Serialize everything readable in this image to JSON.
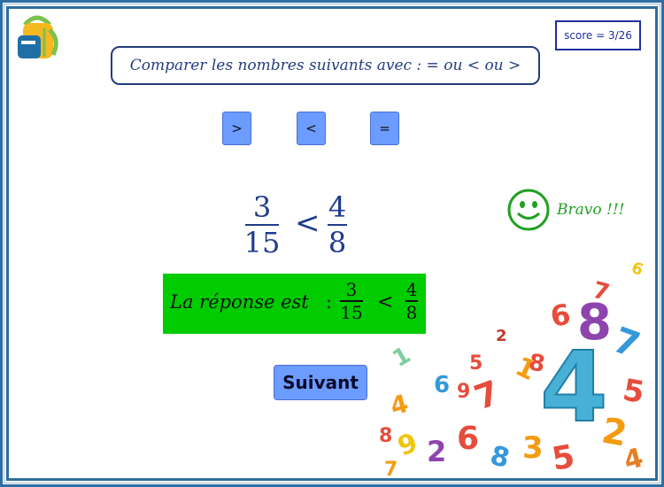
{
  "score": {
    "text": "score = 3/26"
  },
  "instruction": {
    "text": "Comparer les nombres suivants avec  :   = ou < ou >"
  },
  "operators": [
    {
      "label": ">"
    },
    {
      "label": "<"
    },
    {
      "label": "="
    }
  ],
  "comparison": {
    "left": {
      "numerator": "3",
      "denominator": "15"
    },
    "relation": "<",
    "right": {
      "numerator": "4",
      "denominator": "8"
    }
  },
  "feedback": {
    "text": "Bravo !!!"
  },
  "answer": {
    "label": "La réponse est",
    "colon": ":",
    "left": {
      "numerator": "3",
      "denominator": "15"
    },
    "relation": "<",
    "right": {
      "numerator": "4",
      "denominator": "8"
    }
  },
  "next_button": {
    "label": "Suivant"
  },
  "colors": {
    "border": "#2d6ea0",
    "button": "#6c9cff",
    "answer_bg": "#00cc00",
    "math": "#1f3c8c",
    "bravo": "#22a022"
  },
  "icons": {
    "top_left": "backpack-icon",
    "feedback": "smiley-icon"
  }
}
